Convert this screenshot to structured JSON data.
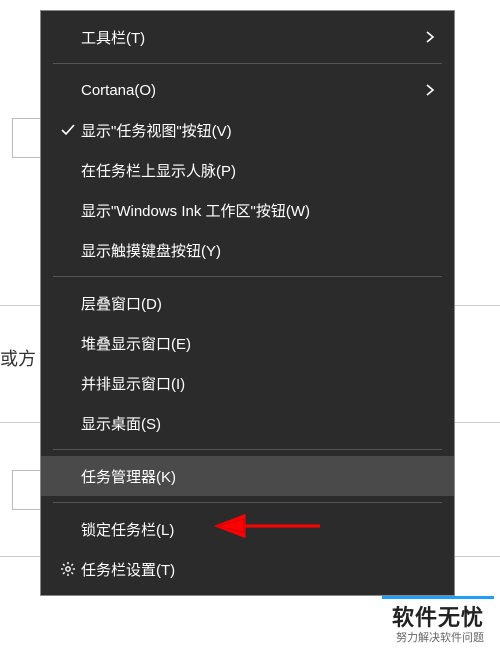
{
  "background": {
    "partial_text": "或方"
  },
  "menu": {
    "items": [
      {
        "label": "工具栏(T)",
        "icon": null,
        "has_submenu": true,
        "hovered": false
      },
      {
        "separator": true
      },
      {
        "label": "Cortana(O)",
        "icon": null,
        "has_submenu": true,
        "hovered": false
      },
      {
        "label": "显示\"任务视图\"按钮(V)",
        "icon": "check",
        "has_submenu": false,
        "hovered": false
      },
      {
        "label": "在任务栏上显示人脉(P)",
        "icon": null,
        "has_submenu": false,
        "hovered": false
      },
      {
        "label": "显示\"Windows Ink 工作区\"按钮(W)",
        "icon": null,
        "has_submenu": false,
        "hovered": false
      },
      {
        "label": "显示触摸键盘按钮(Y)",
        "icon": null,
        "has_submenu": false,
        "hovered": false
      },
      {
        "separator": true
      },
      {
        "label": "层叠窗口(D)",
        "icon": null,
        "has_submenu": false,
        "hovered": false
      },
      {
        "label": "堆叠显示窗口(E)",
        "icon": null,
        "has_submenu": false,
        "hovered": false
      },
      {
        "label": "并排显示窗口(I)",
        "icon": null,
        "has_submenu": false,
        "hovered": false
      },
      {
        "label": "显示桌面(S)",
        "icon": null,
        "has_submenu": false,
        "hovered": false
      },
      {
        "separator": true
      },
      {
        "label": "任务管理器(K)",
        "icon": null,
        "has_submenu": false,
        "hovered": true
      },
      {
        "separator": true
      },
      {
        "label": "锁定任务栏(L)",
        "icon": null,
        "has_submenu": false,
        "hovered": false
      },
      {
        "label": "任务栏设置(T)",
        "icon": "gear",
        "has_submenu": false,
        "hovered": false
      }
    ]
  },
  "annotation": {
    "arrow_color": "#ff0000"
  },
  "watermark": {
    "title": "软件无忧",
    "subtitle": "努力解决软件问题"
  }
}
